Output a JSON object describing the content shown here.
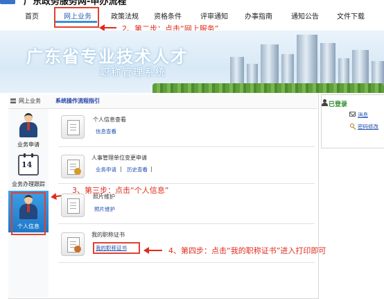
{
  "header": {
    "site_title": "广东政务服务网-申办流程"
  },
  "nav": {
    "items": [
      "首页",
      "网上业务",
      "政策法规",
      "资格条件",
      "评审通知",
      "办事指南",
      "通知公告",
      "文件下载"
    ],
    "active_index": 1
  },
  "banner": {
    "title": "广东省专业技术人才",
    "subtitle": "职称管理系统"
  },
  "left_panel": {
    "header_label": "网上业务",
    "guide_link": "系统操作流程指引"
  },
  "sidebar": {
    "items": [
      "业务申请",
      "业务办理跟踪",
      "个人信息"
    ],
    "calendar_number": "14"
  },
  "content": {
    "rows": [
      {
        "title": "个人信息查看",
        "links": [
          "信息查看"
        ]
      },
      {
        "title": "人事管理单位变更申请",
        "links": [
          "业务申请",
          "历史查看"
        ],
        "sep": "|"
      },
      {
        "title": "照片维护",
        "links": [
          "照片维护"
        ]
      },
      {
        "title": "我的职称证书",
        "links": [
          "我的职称证书"
        ]
      }
    ]
  },
  "right_panel": {
    "status": "已登录",
    "message_link": "消息",
    "password_link": "密码修改"
  },
  "annotations": {
    "step2": "2、第二步：点击“网上服务”",
    "step3": "3、第三步：点击“个人信息”",
    "step4": "4、第四步：点击“我的职称证书”进入打印即可"
  }
}
